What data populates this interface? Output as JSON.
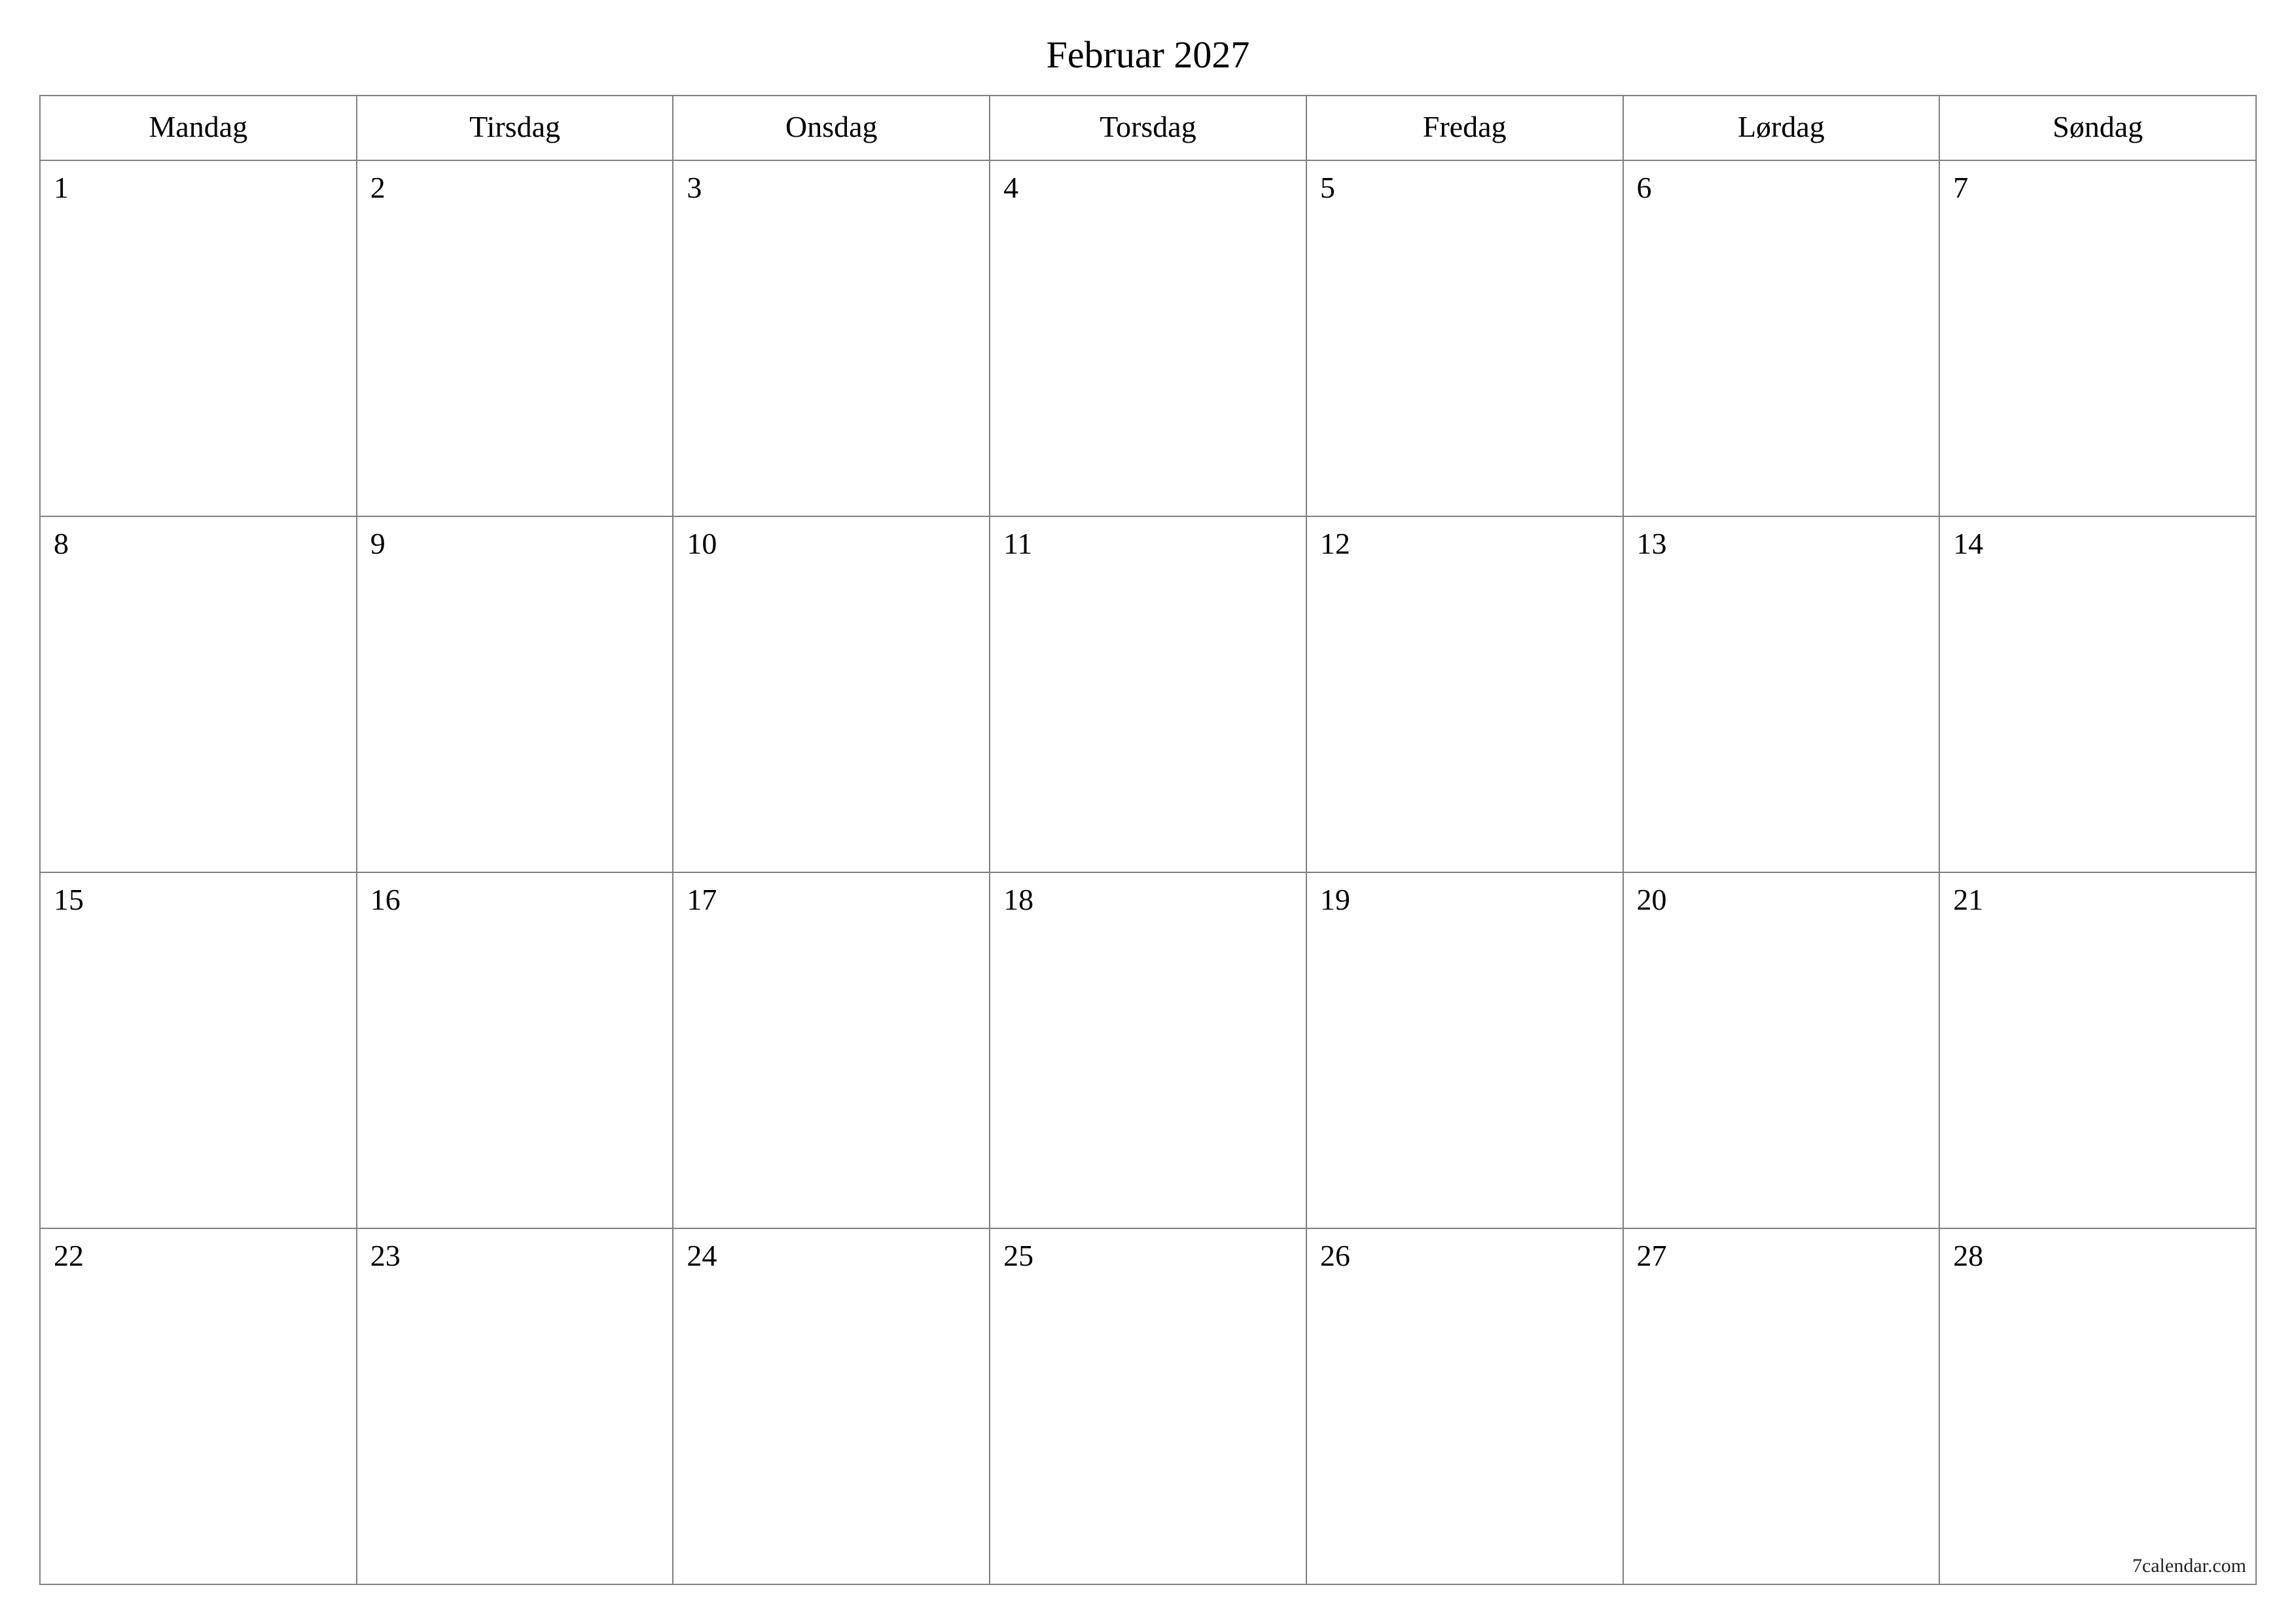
{
  "title": "Februar 2027",
  "weekdays": [
    "Mandag",
    "Tirsdag",
    "Onsdag",
    "Torsdag",
    "Fredag",
    "Lørdag",
    "Søndag"
  ],
  "weeks": [
    [
      "1",
      "2",
      "3",
      "4",
      "5",
      "6",
      "7"
    ],
    [
      "8",
      "9",
      "10",
      "11",
      "12",
      "13",
      "14"
    ],
    [
      "15",
      "16",
      "17",
      "18",
      "19",
      "20",
      "21"
    ],
    [
      "22",
      "23",
      "24",
      "25",
      "26",
      "27",
      "28"
    ]
  ],
  "watermark": "7calendar.com"
}
